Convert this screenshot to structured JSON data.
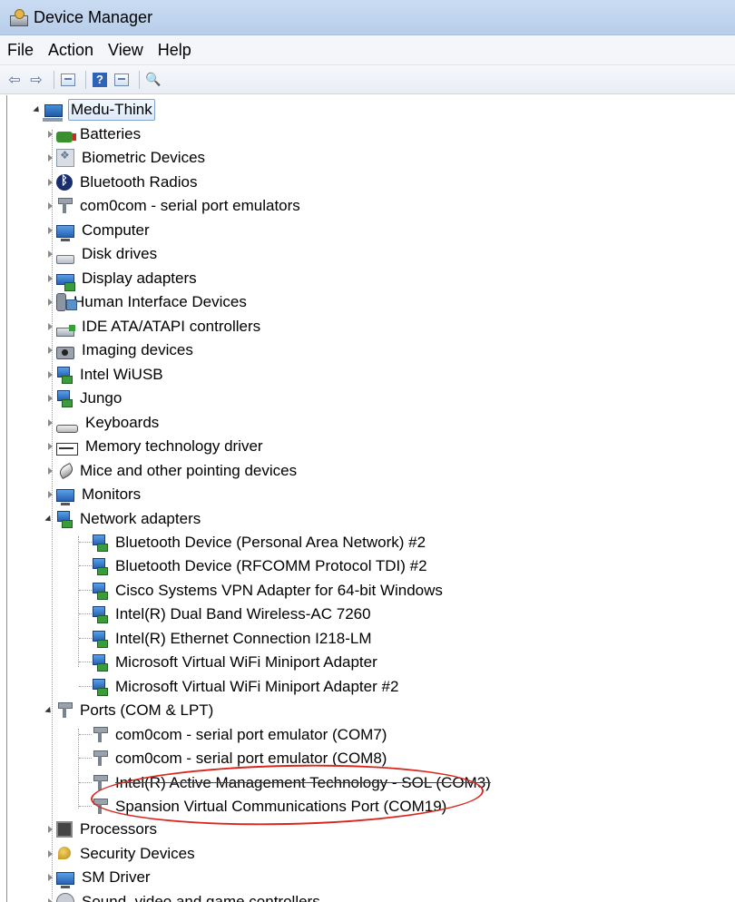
{
  "window": {
    "title": "Device Manager"
  },
  "menu": {
    "file": "File",
    "action": "Action",
    "view": "View",
    "help": "Help"
  },
  "toolbar": {
    "back_icon": "back-arrow-icon",
    "forward_icon": "forward-arrow-icon",
    "help_glyph": "?"
  },
  "tree": {
    "root": "Medu-Think",
    "categories": {
      "batteries": "Batteries",
      "biometric": "Biometric Devices",
      "bluetooth": "Bluetooth Radios",
      "com0com": "com0com - serial port emulators",
      "computer": "Computer",
      "disk": "Disk drives",
      "display": "Display adapters",
      "hid": "Human Interface Devices",
      "ide": "IDE ATA/ATAPI controllers",
      "imaging": "Imaging devices",
      "wiusb": "Intel WiUSB",
      "jungo": "Jungo",
      "keyboards": "Keyboards",
      "memory": "Memory technology driver",
      "mice": "Mice and other pointing devices",
      "monitors": "Monitors",
      "network": "Network adapters",
      "ports": "Ports (COM & LPT)",
      "processors": "Processors",
      "security": "Security Devices",
      "smdriver": "SM Driver",
      "sound": "Sound, video and game controllers"
    },
    "network_children": [
      "Bluetooth Device (Personal Area Network) #2",
      "Bluetooth Device (RFCOMM Protocol TDI) #2",
      "Cisco Systems VPN Adapter for 64-bit Windows",
      "Intel(R) Dual Band Wireless-AC 7260",
      "Intel(R) Ethernet Connection I218-LM",
      "Microsoft Virtual WiFi Miniport Adapter",
      "Microsoft Virtual WiFi Miniport Adapter #2"
    ],
    "ports_children": [
      "com0com - serial port emulator (COM7)",
      "com0com - serial port emulator (COM8)",
      "Intel(R) Active Management Technology - SOL (COM3)",
      "Spansion Virtual Communications Port (COM19)"
    ]
  },
  "annotation_color": "#d9281f"
}
